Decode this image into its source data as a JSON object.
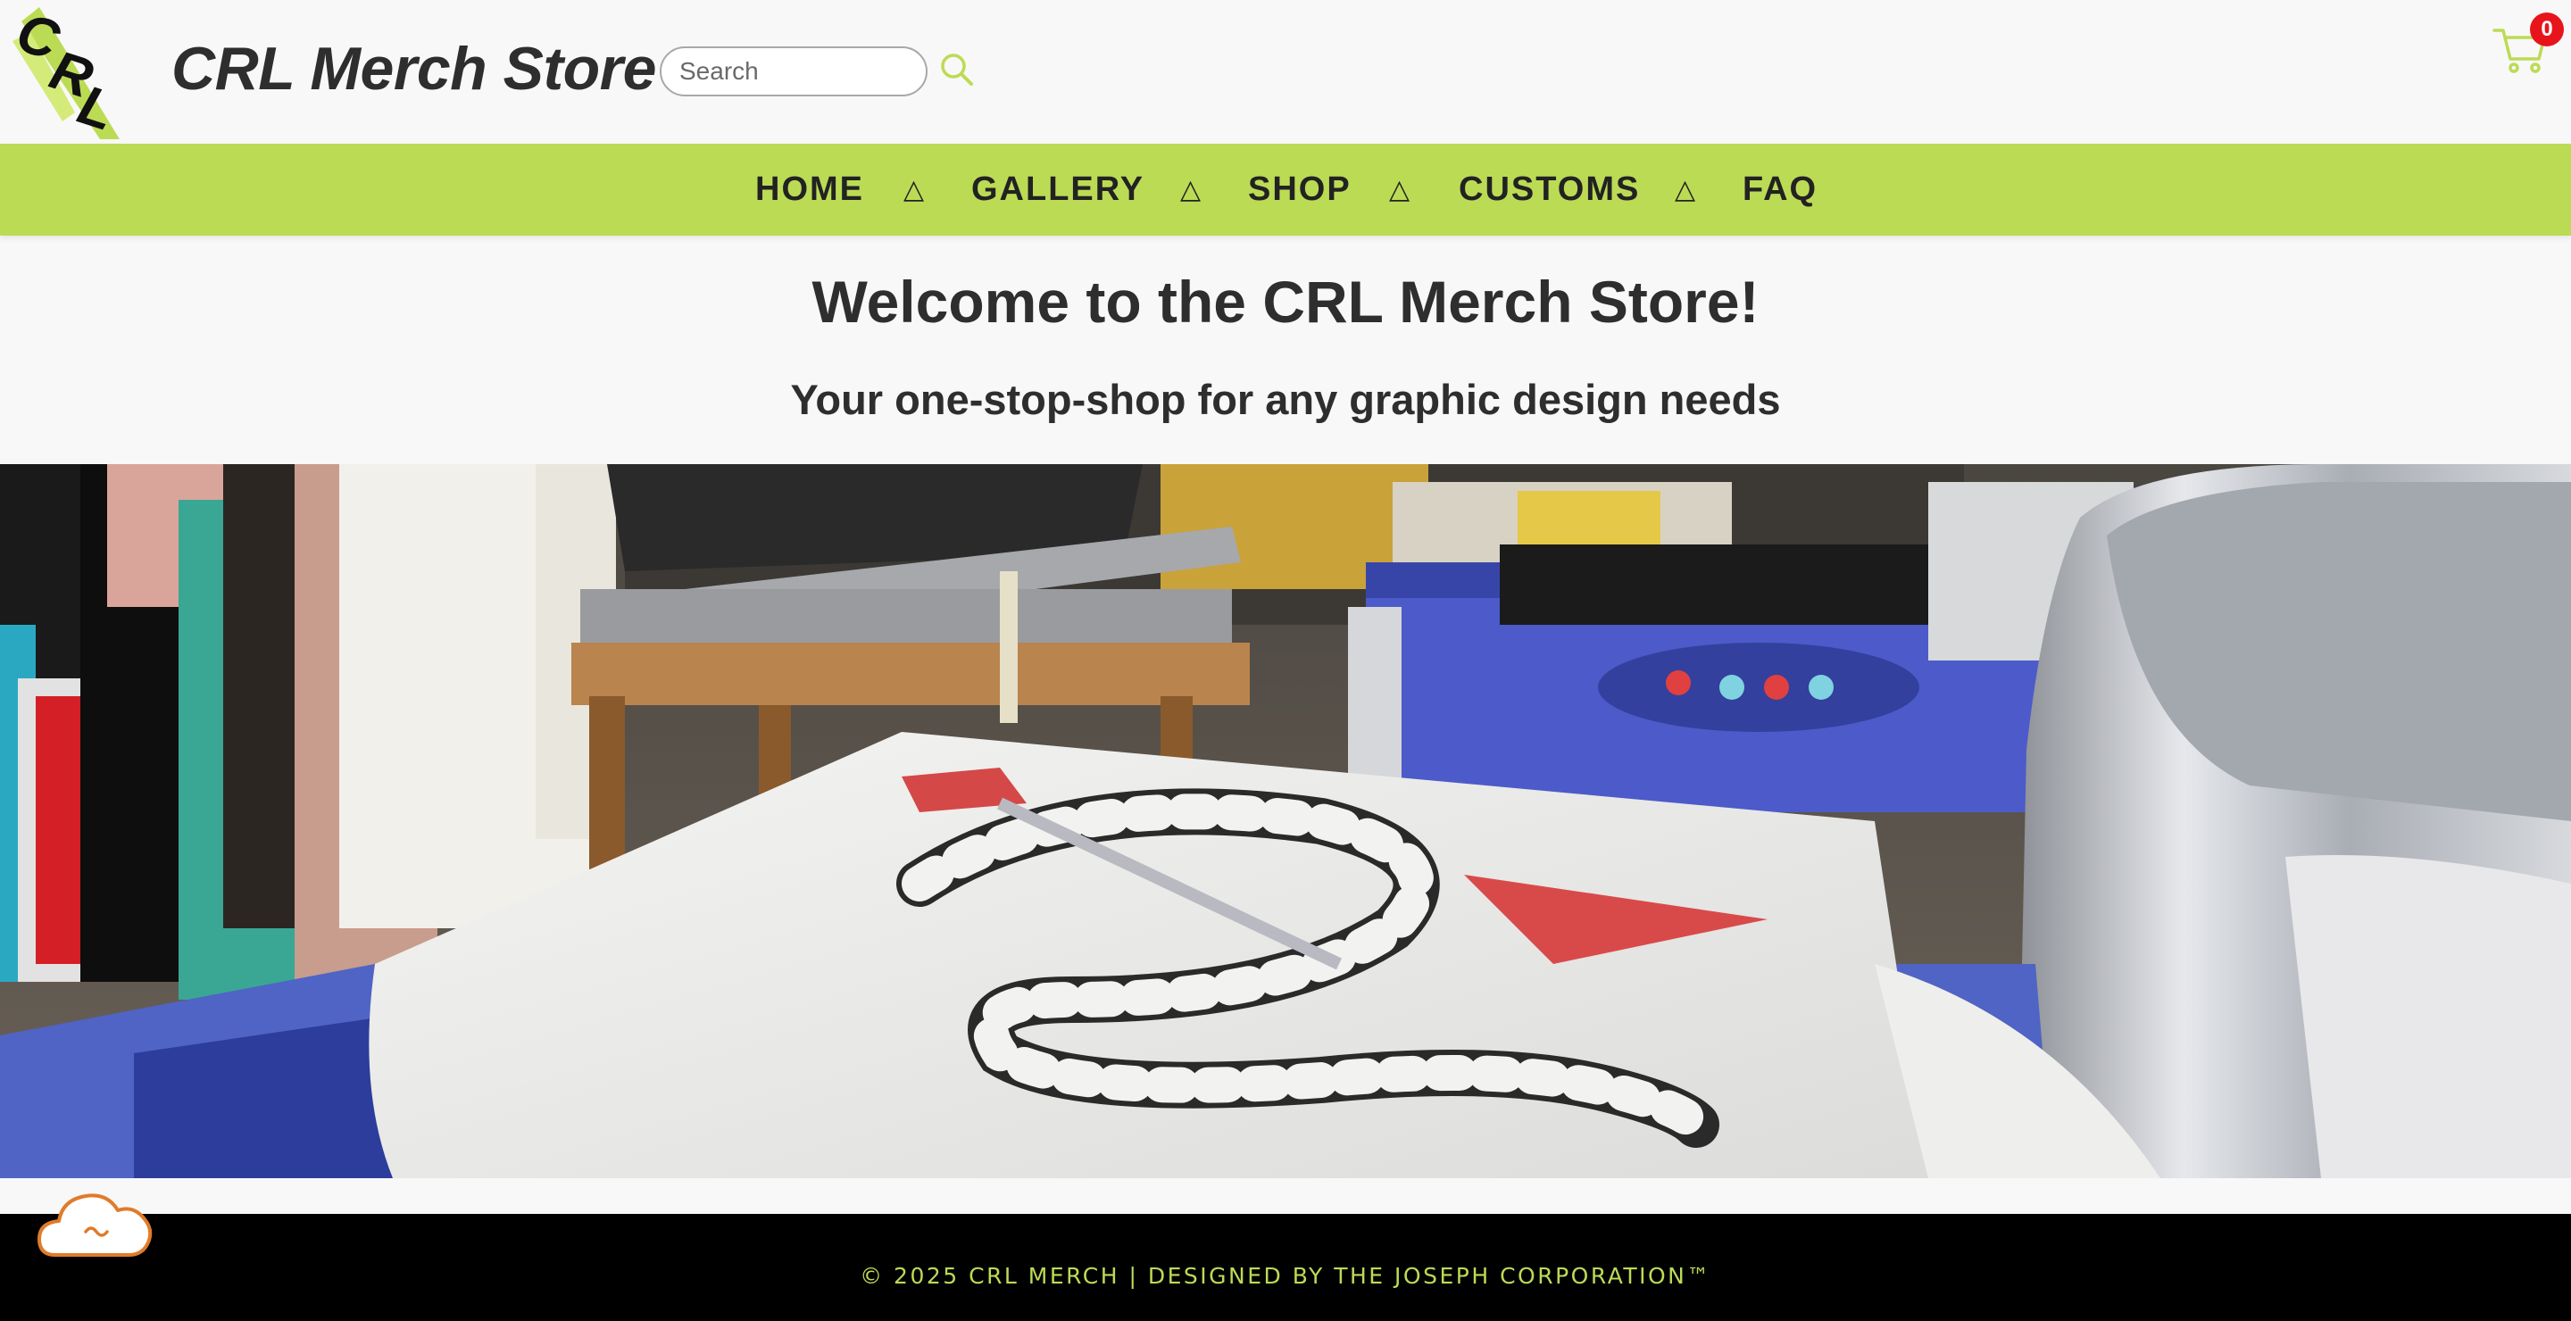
{
  "header": {
    "logo_text": "CRL",
    "site_title": "CRL Merch Store",
    "search": {
      "placeholder": "Search",
      "value": ""
    },
    "search_icon": "magnifier-icon",
    "cart_icon": "shopping-cart-icon",
    "cart_count": "0"
  },
  "nav": {
    "items": [
      {
        "label": "HOME"
      },
      {
        "label": "GALLERY"
      },
      {
        "label": "SHOP"
      },
      {
        "label": "CUSTOMS"
      },
      {
        "label": "FAQ"
      }
    ],
    "separator": "△"
  },
  "hero": {
    "heading": "Welcome to the CRL Merch Store!",
    "subheading": "Your one-stop-shop for any graphic design needs",
    "image_subject": "snake-print-shirt-on-press-photo"
  },
  "footer": {
    "text": "© 2025 CRL MERCH | DESIGNED BY THE JOSEPH CORPORATION™",
    "chat_icon": "cloud-chat-icon"
  },
  "colors": {
    "accent_green": "#bcdb55",
    "page_bg": "#f8f8f8",
    "text_dark": "#2e2e2e",
    "badge_red": "#e8141b",
    "footer_bg": "#000000",
    "chat_orange": "#e07b2a"
  }
}
